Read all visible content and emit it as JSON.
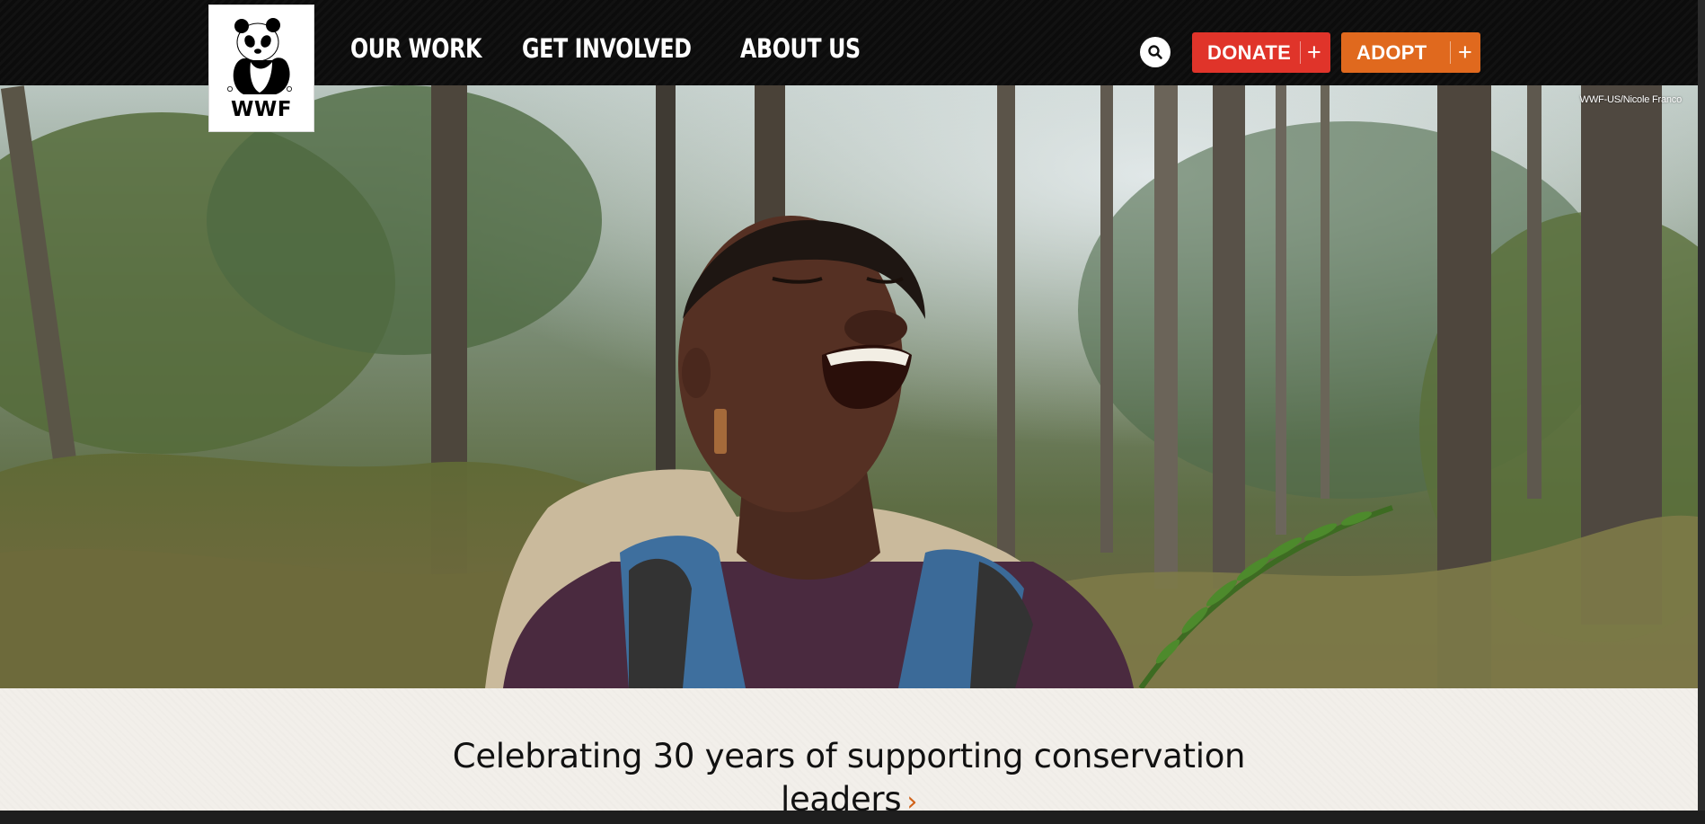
{
  "brand": {
    "logo_text": "WWF"
  },
  "nav": {
    "items": [
      {
        "label": "OUR WORK"
      },
      {
        "label": "GET INVOLVED"
      },
      {
        "label": "ABOUT US"
      }
    ],
    "search_icon": "search-icon",
    "donate_label": "DONATE",
    "adopt_label": "ADOPT",
    "plus_glyph": "+"
  },
  "hero": {
    "photo_credit": "WWF-US/Nicole Franco"
  },
  "caption": {
    "text": "Celebrating 30 years of supporting conservation leaders",
    "chevron": "›"
  },
  "colors": {
    "donate": "#e0342a",
    "adopt": "#e0691e",
    "accent_chevron": "#d1631a",
    "nav_bg": "#0c0c0c",
    "caption_bg": "#f2efea"
  }
}
